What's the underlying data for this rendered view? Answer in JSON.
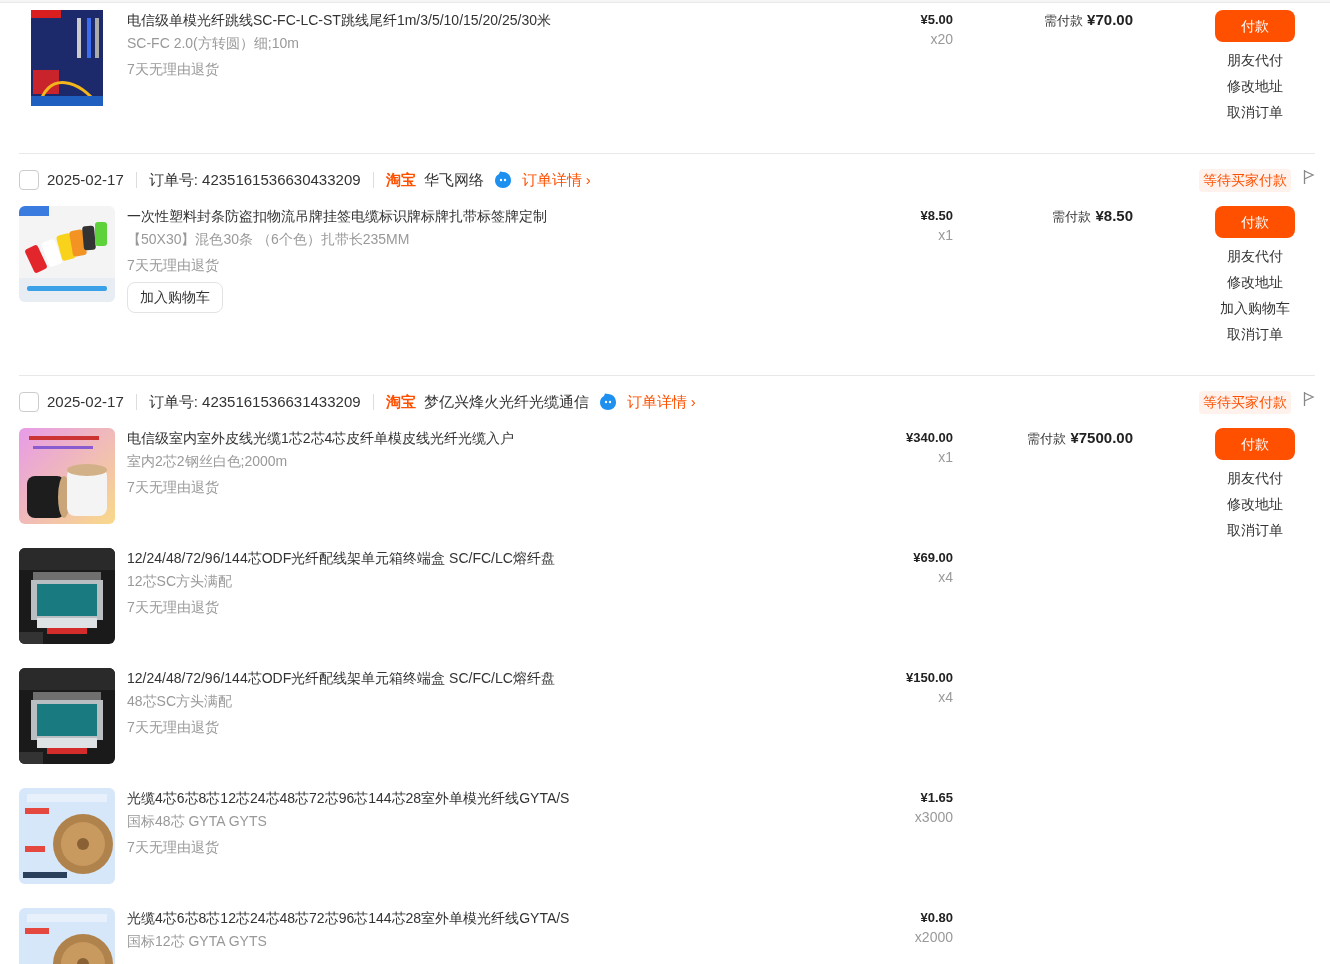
{
  "orders": [
    {
      "items": [
        {
          "title": "电信级单模光纤跳线SC-FC-LC-ST跳线尾纤1m/3/5/10/15/20/25/30米",
          "spec": "SC-FC 2.0(方转圆）细;10m",
          "return_policy": "7天无理由退货",
          "price": "¥5.00",
          "quantity": "x20"
        }
      ],
      "total": {
        "label": "需付款",
        "amount": "¥70.00"
      },
      "actions": [
        {
          "kind": "primary",
          "label": "付款"
        },
        {
          "kind": "link",
          "label": "朋友代付"
        },
        {
          "kind": "link",
          "label": "修改地址"
        },
        {
          "kind": "link",
          "label": "取消订单"
        }
      ]
    },
    {
      "header": {
        "checked": false,
        "date": "2025-02-17",
        "order_number": "订单号: 4235161536630433209",
        "platform": "淘宝",
        "shop": "华飞网络",
        "detail_link": "订单详情",
        "detail_arrow": "›",
        "status": "等待买家付款"
      },
      "items": [
        {
          "title": "一次性塑料封条防盗扣物流吊牌挂签电缆标识牌标牌扎带标签牌定制",
          "spec": "【50X30】混色30条 （6个色）扎带长235MM",
          "return_policy": "7天无理由退货",
          "cart_button": "加入购物车",
          "price": "¥8.50",
          "quantity": "x1"
        }
      ],
      "total": {
        "label": "需付款",
        "amount": "¥8.50"
      },
      "actions": [
        {
          "kind": "primary",
          "label": "付款"
        },
        {
          "kind": "link",
          "label": "朋友代付"
        },
        {
          "kind": "link",
          "label": "修改地址"
        },
        {
          "kind": "link",
          "label": "加入购物车"
        },
        {
          "kind": "link",
          "label": "取消订单"
        }
      ]
    },
    {
      "header": {
        "checked": false,
        "date": "2025-02-17",
        "order_number": "订单号: 4235161536631433209",
        "platform": "淘宝",
        "shop": "梦亿兴烽火光纤光缆通信",
        "detail_link": "订单详情",
        "detail_arrow": "›",
        "status": "等待买家付款"
      },
      "items": [
        {
          "title": "电信级室内室外皮线光缆1芯2芯4芯皮纤单模皮线光纤光缆入户",
          "spec": "室内2芯2钢丝白色;2000m",
          "return_policy": "7天无理由退货",
          "price": "¥340.00",
          "quantity": "x1"
        },
        {
          "title": "12/24/48/72/96/144芯ODF光纤配线架单元箱终端盒 SC/FC/LC熔纤盘",
          "spec": "12芯SC方头满配",
          "return_policy": "7天无理由退货",
          "price": "¥69.00",
          "quantity": "x4"
        },
        {
          "title": "12/24/48/72/96/144芯ODF光纤配线架单元箱终端盒 SC/FC/LC熔纤盘",
          "spec": "48芯SC方头满配",
          "return_policy": "7天无理由退货",
          "price": "¥150.00",
          "quantity": "x4"
        },
        {
          "title": "光缆4芯6芯8芯12芯24芯48芯72芯96芯144芯28室外单模光纤线GYTA/S",
          "spec": "国标48芯 GYTA GYTS",
          "return_policy": "7天无理由退货",
          "price": "¥1.65",
          "quantity": "x3000"
        },
        {
          "title": "光缆4芯6芯8芯12芯24芯48芯72芯96芯144芯28室外单模光纤线GYTA/S",
          "spec": "国标12芯 GYTA GYTS",
          "price": "¥0.80",
          "quantity": "x2000"
        }
      ],
      "total": {
        "label": "需付款",
        "amount": "¥7500.00"
      },
      "actions": [
        {
          "kind": "primary",
          "label": "付款"
        },
        {
          "kind": "link",
          "label": "朋友代付"
        },
        {
          "kind": "link",
          "label": "修改地址"
        },
        {
          "kind": "link",
          "label": "取消订单"
        }
      ]
    }
  ]
}
